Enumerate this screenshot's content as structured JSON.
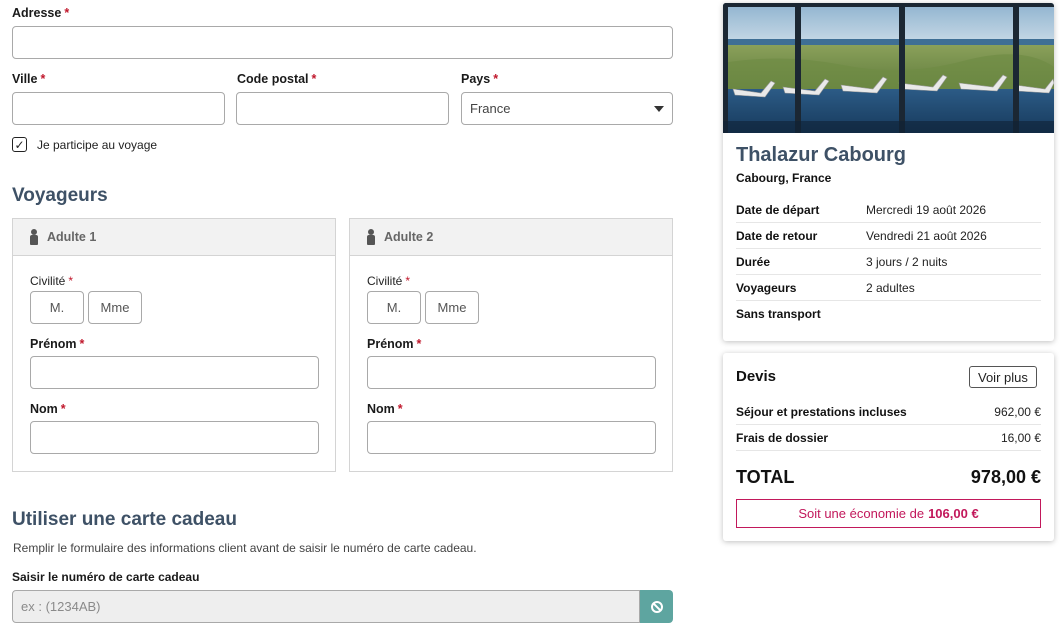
{
  "form": {
    "address": {
      "label": "Adresse",
      "req": "*",
      "value": ""
    },
    "city": {
      "label": "Ville",
      "req": "*",
      "value": ""
    },
    "postal": {
      "label": "Code postal",
      "req": "*",
      "value": ""
    },
    "country": {
      "label": "Pays",
      "req": "*",
      "value": "France"
    },
    "participate": {
      "checked_glyph": "✓",
      "label": "Je participe au voyage"
    }
  },
  "travelers": {
    "title": "Voyageurs",
    "cards": [
      {
        "header": "Adulte 1",
        "civility_label": "Civilité",
        "civility_options": [
          "M.",
          "Mme"
        ],
        "firstname_label": "Prénom",
        "lastname_label": "Nom"
      },
      {
        "header": "Adulte 2",
        "civility_label": "Civilité",
        "civility_options": [
          "M.",
          "Mme"
        ],
        "firstname_label": "Prénom",
        "lastname_label": "Nom"
      }
    ],
    "req": "*"
  },
  "gift": {
    "title": "Utiliser une carte cadeau",
    "description": "Remplir le formulaire des informations client avant de saisir le numéro de carte cadeau.",
    "label": "Saisir le numéro de carte cadeau",
    "placeholder": "ex : (1234AB)"
  },
  "summary": {
    "hotel_name": "Thalazur Cabourg",
    "location": "Cabourg, France",
    "rows": [
      {
        "k": "Date de départ",
        "v": "Mercredi 19 août 2026"
      },
      {
        "k": "Date de retour",
        "v": "Vendredi 21 août 2026"
      },
      {
        "k": "Durée",
        "v": "3 jours / 2 nuits"
      },
      {
        "k": "Voyageurs",
        "v": "2 adultes"
      },
      {
        "k": "Sans transport",
        "v": ""
      }
    ]
  },
  "quote": {
    "title": "Devis",
    "more_label": "Voir plus",
    "rows": [
      {
        "k": "Séjour et prestations incluses",
        "v": "962,00 €"
      },
      {
        "k": "Frais de dossier",
        "v": "16,00 €"
      }
    ],
    "total_label": "TOTAL",
    "total_value": "978,00 €",
    "savings_prefix": "Soit une économie de",
    "savings_value": "106,00 €"
  },
  "colors": {
    "accent_title": "#3e5166",
    "required": "#c0172b",
    "savings": "#c2185b",
    "gift_button": "#5ea5a0"
  }
}
